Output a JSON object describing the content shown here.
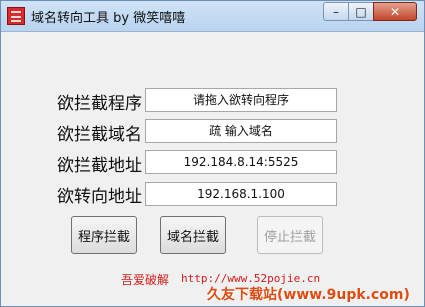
{
  "window": {
    "title": "域名转向工具 by 微笑嘻嘻",
    "minimize_glyph": "–",
    "maximize_glyph": "□",
    "close_glyph": "✕"
  },
  "form": {
    "rows": [
      {
        "label": "欲拦截程序",
        "value": "请拖入欲转向程序"
      },
      {
        "label": "欲拦截域名",
        "value": "疏 输入域名"
      },
      {
        "label": "欲拦截地址",
        "value": "192.184.8.14:5525"
      },
      {
        "label": "欲转向地址",
        "value": "192.168.1.100"
      }
    ]
  },
  "buttons": {
    "block_program": "程序拦截",
    "block_domain": "域名拦截",
    "stop_block": "停止拦截"
  },
  "footer": {
    "credit": "吾爱破解",
    "url": "http://www.52pojie.cn"
  },
  "watermark": "久友下载站(www.9upk.com)",
  "colors": {
    "accent_red": "#d21a1a",
    "watermark_orange": "#e04b10"
  }
}
